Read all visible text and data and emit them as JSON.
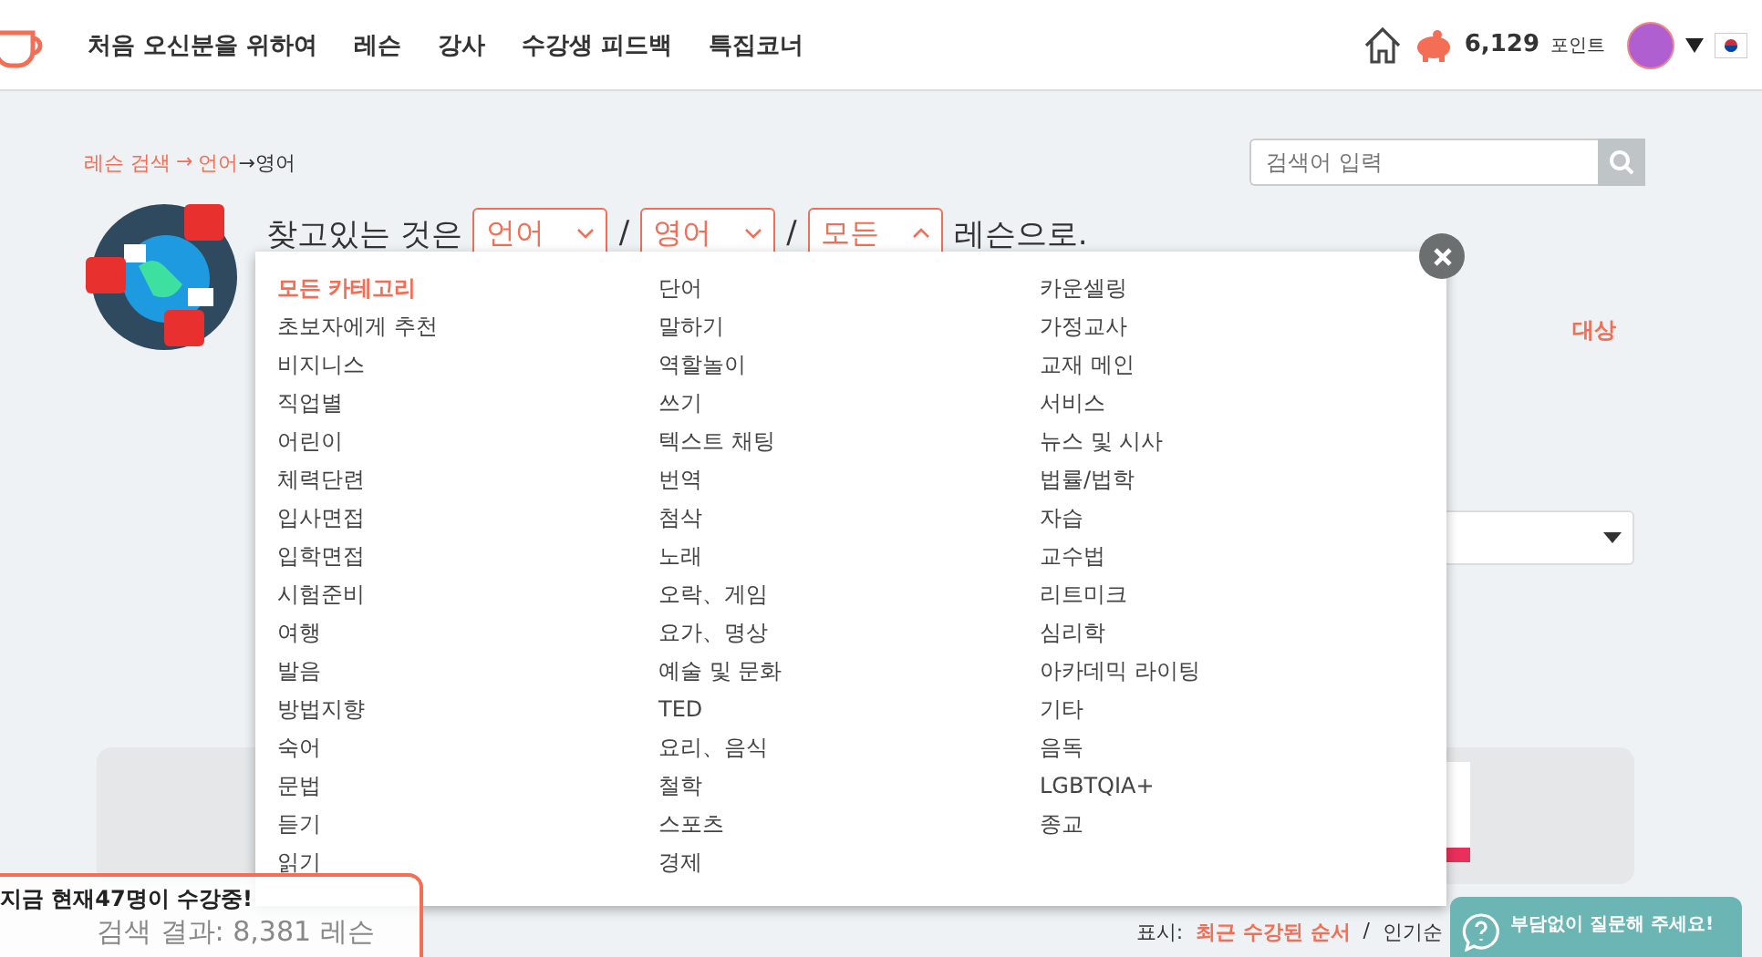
{
  "header": {
    "nav": [
      "처음 오신분을 위하여",
      "레슨",
      "강사",
      "수강생 피드백",
      "특집코너"
    ],
    "points": "6,129",
    "points_unit": "포인트"
  },
  "breadcrumb": [
    {
      "label": "레슨 검색",
      "kind": "link"
    },
    {
      "label": "→",
      "kind": "sep"
    },
    {
      "label": "언어",
      "kind": "link"
    },
    {
      "label": "→영어",
      "kind": "current"
    }
  ],
  "search": {
    "placeholder": "검색어 입력"
  },
  "query": {
    "prefix": "찾고있는 것은",
    "filters": [
      {
        "value": "언어",
        "expanded": false
      },
      {
        "value": "영어",
        "expanded": false
      },
      {
        "value": "모든",
        "expanded": true
      }
    ],
    "separator": "/",
    "suffix": "레슨으로."
  },
  "category_menu": {
    "columns": [
      [
        {
          "label": "모든 카테고리",
          "selected": true
        },
        {
          "label": "초보자에게 추천",
          "selected": false
        },
        {
          "label": "비지니스",
          "selected": false
        },
        {
          "label": "직업별",
          "selected": false
        },
        {
          "label": "어린이",
          "selected": false
        },
        {
          "label": "체력단련",
          "selected": false
        },
        {
          "label": "입사면접",
          "selected": false
        },
        {
          "label": "입학면접",
          "selected": false
        },
        {
          "label": "시험준비",
          "selected": false
        },
        {
          "label": "여행",
          "selected": false
        },
        {
          "label": "발음",
          "selected": false
        },
        {
          "label": "방법지향",
          "selected": false
        },
        {
          "label": "숙어",
          "selected": false
        },
        {
          "label": "문법",
          "selected": false
        },
        {
          "label": "듣기",
          "selected": false
        },
        {
          "label": "읽기",
          "selected": false
        }
      ],
      [
        {
          "label": "단어",
          "selected": false
        },
        {
          "label": "말하기",
          "selected": false
        },
        {
          "label": "역할놀이",
          "selected": false
        },
        {
          "label": "쓰기",
          "selected": false
        },
        {
          "label": "텍스트 채팅",
          "selected": false
        },
        {
          "label": "번역",
          "selected": false
        },
        {
          "label": "첨삭",
          "selected": false
        },
        {
          "label": "노래",
          "selected": false
        },
        {
          "label": "오락、게임",
          "selected": false
        },
        {
          "label": "요가、명상",
          "selected": false
        },
        {
          "label": "예술 및 문화",
          "selected": false
        },
        {
          "label": "TED",
          "selected": false
        },
        {
          "label": "요리、음식",
          "selected": false
        },
        {
          "label": "철학",
          "selected": false
        },
        {
          "label": "스포츠",
          "selected": false
        },
        {
          "label": "경제",
          "selected": false
        }
      ],
      [
        {
          "label": "카운셀링",
          "selected": false
        },
        {
          "label": "가정교사",
          "selected": false
        },
        {
          "label": "교재 메인",
          "selected": false
        },
        {
          "label": "서비스",
          "selected": false
        },
        {
          "label": "뉴스 및 시사",
          "selected": false
        },
        {
          "label": "법률/법학",
          "selected": false
        },
        {
          "label": "자습",
          "selected": false
        },
        {
          "label": "교수법",
          "selected": false
        },
        {
          "label": "리트미크",
          "selected": false
        },
        {
          "label": "심리학",
          "selected": false
        },
        {
          "label": "아카데믹 라이팅",
          "selected": false
        },
        {
          "label": "기타",
          "selected": false
        },
        {
          "label": "음독",
          "selected": false
        },
        {
          "label": "LGBTQIA+",
          "selected": false
        },
        {
          "label": "종교",
          "selected": false
        }
      ]
    ]
  },
  "target_label": "대상",
  "results": {
    "count": "검색 결과: 8,381 레슨",
    "sort_label": "표시:",
    "sort_options": [
      {
        "label": "최근 수강된 순서",
        "selected": true
      },
      {
        "label": "인기순",
        "selected": false
      }
    ]
  },
  "toast": "지금 현재47명이 수강중!",
  "help_button": "부담없이 질문해 주세요!"
}
